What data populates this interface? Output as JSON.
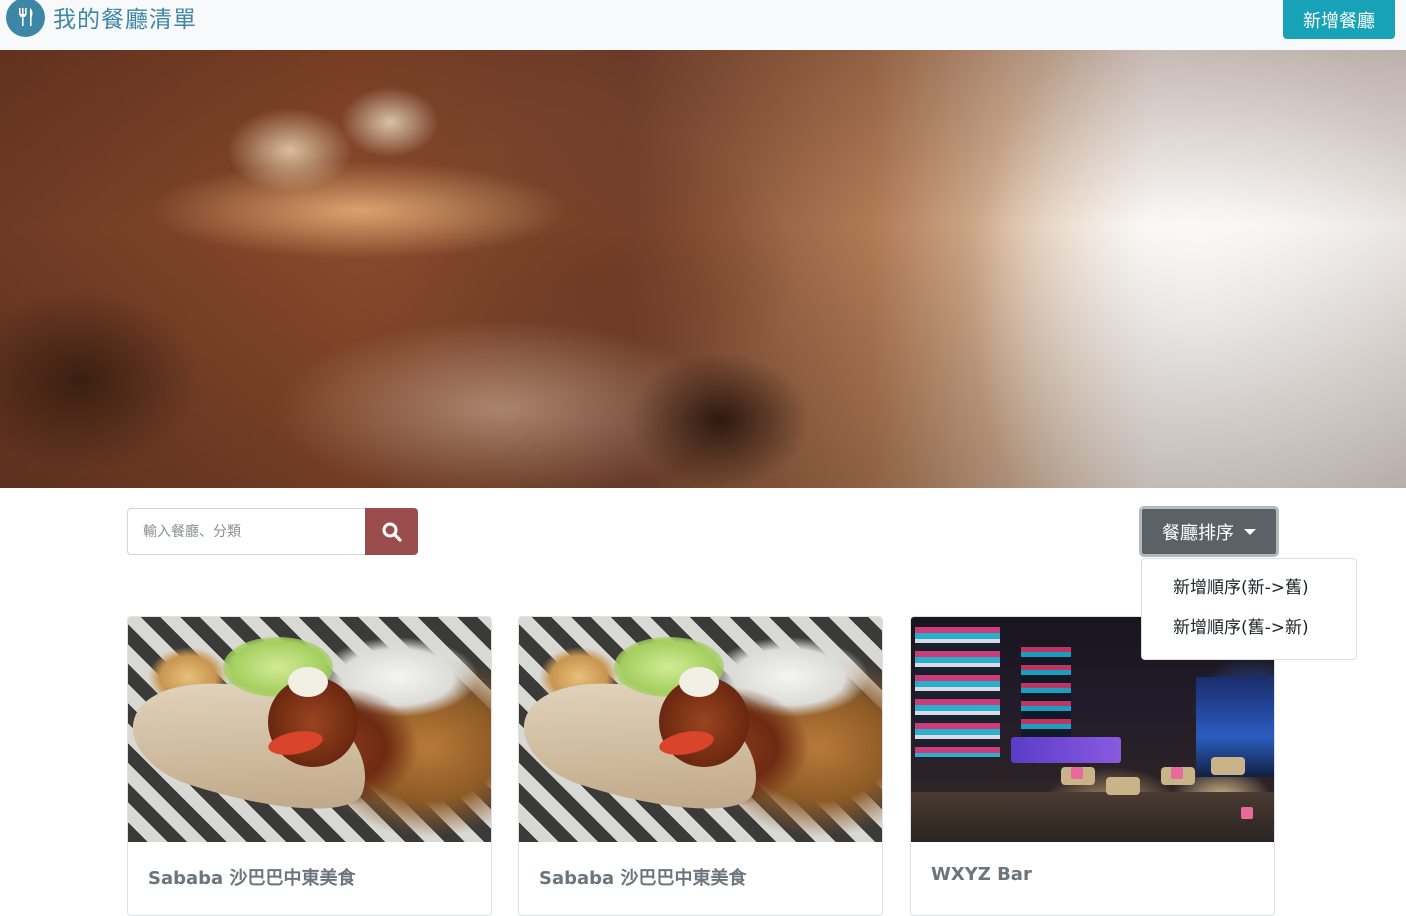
{
  "navbar": {
    "brand_title": "我的餐廳清單",
    "logo_icon": "fork-knife-icon",
    "add_button": "新增餐廳",
    "accent_color": "#3e86a6",
    "button_color": "#17a2b8"
  },
  "search": {
    "placeholder": "輸入餐廳、分類",
    "button_icon": "search-icon",
    "button_color": "#9b4d4d"
  },
  "sort": {
    "label": "餐廳排序",
    "options": [
      "新增順序(新->舊)",
      "新增順序(舊->新)"
    ]
  },
  "restaurants": [
    {
      "name": "Sababa 沙巴巴中東美食",
      "image": "falafel-pita-photo"
    },
    {
      "name": "Sababa 沙巴巴中東美食",
      "image": "falafel-pita-photo"
    },
    {
      "name": "WXYZ Bar",
      "image": "lounge-bar-photo"
    }
  ]
}
